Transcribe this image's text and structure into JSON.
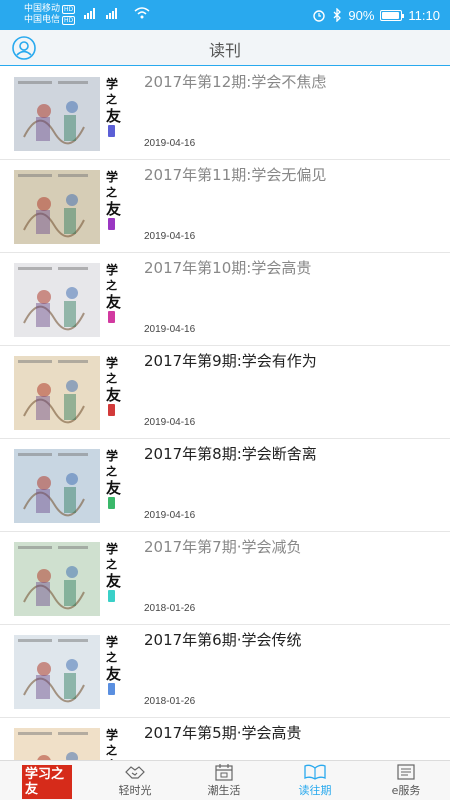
{
  "status_bar": {
    "carrier1": "中国移动",
    "carrier2": "中国电信",
    "hd": "HD",
    "battery_text": "90%",
    "battery_level": 0.9,
    "time": "11:10"
  },
  "header": {
    "title": "读刊"
  },
  "issues": [
    {
      "title": "2017年第12期:学会不焦虑",
      "date": "2019-04-16",
      "read": true,
      "seal_color": "#5b5fd6",
      "art_bg": "#cfd5dd"
    },
    {
      "title": "2017年第11期:学会无偏见",
      "date": "2019-04-16",
      "read": true,
      "seal_color": "#9a37c2",
      "art_bg": "#d6cdb6"
    },
    {
      "title": "2017年第10期:学会高贵",
      "date": "2019-04-16",
      "read": true,
      "seal_color": "#d23aa0",
      "art_bg": "#e7e7ea"
    },
    {
      "title": "2017年第9期:学会有作为",
      "date": "2019-04-16",
      "read": false,
      "seal_color": "#d23a3a",
      "art_bg": "#e9dcc4"
    },
    {
      "title": "2017年第8期:学会断舍离",
      "date": "2019-04-16",
      "read": false,
      "seal_color": "#3ab86a",
      "art_bg": "#c8d6e2"
    },
    {
      "title": "2017年第7期·学会减负",
      "date": "2018-01-26",
      "read": true,
      "seal_color": "#3ad0c8",
      "art_bg": "#cfe0cf"
    },
    {
      "title": "2017年第6期·学会传统",
      "date": "2018-01-26",
      "read": false,
      "seal_color": "#5a8fe0",
      "art_bg": "#dfe6ec"
    },
    {
      "title": "2017年第5期·学会高贵",
      "date": "",
      "read": false,
      "seal_color": "#e0a03a",
      "art_bg": "#f0e0c8"
    }
  ],
  "cover_calligraphy": [
    "学",
    "之",
    "友"
  ],
  "bottom_nav": {
    "logo_text": "学习之友",
    "tabs": [
      {
        "label": "轻时光",
        "icon": "handshake-icon",
        "active": false
      },
      {
        "label": "潮生活",
        "icon": "calendar-icon",
        "active": false
      },
      {
        "label": "读往期",
        "icon": "open-book-icon",
        "active": true
      },
      {
        "label": "e服务",
        "icon": "newspaper-icon",
        "active": false
      }
    ]
  },
  "colors": {
    "accent": "#29a9ee",
    "logo_red": "#d62b1a"
  }
}
